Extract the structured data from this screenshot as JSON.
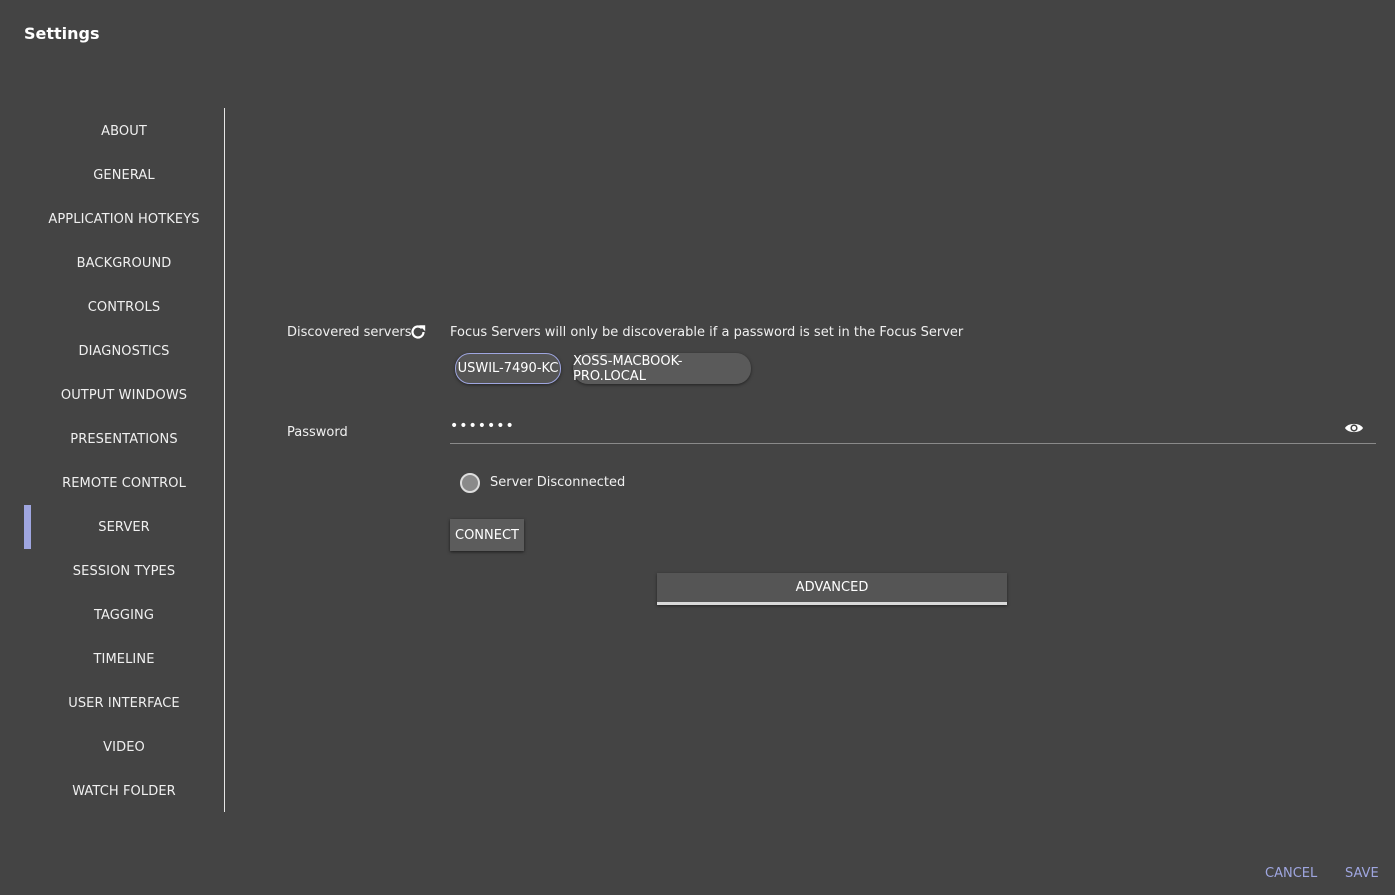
{
  "window": {
    "title": "Settings"
  },
  "sidebar": {
    "items": [
      {
        "label": "ABOUT"
      },
      {
        "label": "GENERAL"
      },
      {
        "label": "APPLICATION HOTKEYS"
      },
      {
        "label": "BACKGROUND"
      },
      {
        "label": "CONTROLS"
      },
      {
        "label": "DIAGNOSTICS"
      },
      {
        "label": "OUTPUT WINDOWS"
      },
      {
        "label": "PRESENTATIONS"
      },
      {
        "label": "REMOTE CONTROL"
      },
      {
        "label": "SERVER",
        "active": true
      },
      {
        "label": "SESSION TYPES"
      },
      {
        "label": "TAGGING"
      },
      {
        "label": "TIMELINE"
      },
      {
        "label": "USER INTERFACE"
      },
      {
        "label": "VIDEO"
      },
      {
        "label": "WATCH FOLDER"
      }
    ]
  },
  "server": {
    "discovered_label": "Discovered servers",
    "refresh_icon": "refresh-icon",
    "hint": "Focus Servers will only be discoverable if a password is set in the Focus Server",
    "servers": [
      {
        "name": "USWIL-7490-KC",
        "selected": true
      },
      {
        "name": "XOSS-MACBOOK-PRO.LOCAL",
        "selected": false
      }
    ],
    "password_label": "Password",
    "password_value": "•••••••",
    "eye_icon": "eye-icon",
    "status": "Server Disconnected",
    "connect_label": "CONNECT",
    "advanced_label": "ADVANCED"
  },
  "footer": {
    "cancel_label": "CANCEL",
    "save_label": "SAVE"
  },
  "colors": {
    "background": "#444444",
    "accent": "#9fa6e0",
    "text": "#f0f0f0"
  }
}
